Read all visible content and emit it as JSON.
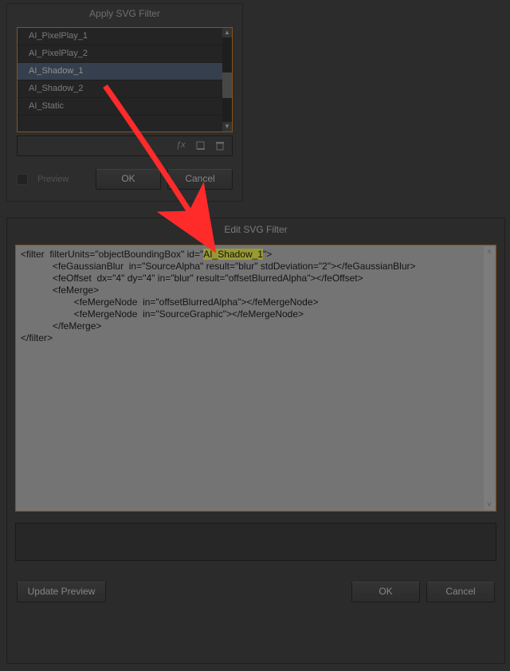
{
  "apply_dialog": {
    "title": "Apply SVG Filter",
    "items": [
      "AI_PixelPlay_1",
      "AI_PixelPlay_2",
      "AI_Shadow_1",
      "AI_Shadow_2",
      "AI_Static"
    ],
    "selected_index": 2,
    "preview_label": "Preview",
    "ok_label": "OK",
    "cancel_label": "Cancel",
    "icons": {
      "fx": "fx",
      "new": "new-filter-icon",
      "trash": "trash-icon"
    }
  },
  "edit_dialog": {
    "title": "Edit SVG Filter",
    "code_pre": "<filter  filterUnits=\"objectBoundingBox\" id=\"",
    "code_hl": "AI_Shadow_1",
    "code_post_line1": "\">",
    "code_rest": "            <feGaussianBlur  in=\"SourceAlpha\" result=\"blur\" stdDeviation=\"2\"></feGaussianBlur>\n            <feOffset  dx=\"4\" dy=\"4\" in=\"blur\" result=\"offsetBlurredAlpha\"></feOffset>\n            <feMerge>\n                    <feMergeNode  in=\"offsetBlurredAlpha\"></feMergeNode>\n                    <feMergeNode  in=\"SourceGraphic\"></feMergeNode>\n            </feMerge>\n</filter>",
    "update_preview_label": "Update Preview",
    "ok_label": "OK",
    "cancel_label": "Cancel"
  }
}
